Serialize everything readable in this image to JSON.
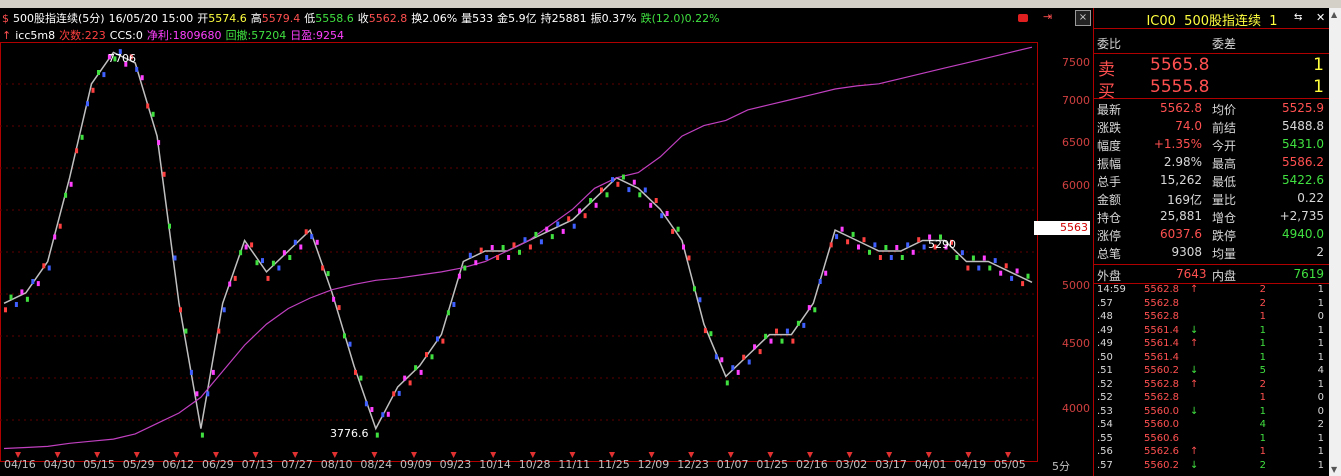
{
  "header": {
    "icon": "dollar-icon",
    "name": "500股指连续",
    "period": "(5分)",
    "datetime": "16/05/20 15:00",
    "open_label": "开",
    "open": "5574.6",
    "high_label": "高",
    "high": "5579.4",
    "low_label": "低",
    "low": "5558.6",
    "close_label": "收",
    "close": "5562.8",
    "turnover": "换2.06%",
    "volume": "量533",
    "amount": "金5.9亿",
    "holding": "持25881",
    "amplitude": "振0.37%",
    "change": "跌(12.0)0.22%"
  },
  "indicator": {
    "arrow": "↑",
    "name": "icc5m8",
    "trades": "次数:223",
    "ccs": "CCS:0",
    "net_profit": "净利:1809680",
    "drawdown": "回撤:57204",
    "daily": "日盈:9254"
  },
  "y_axis": [
    "7500",
    "7000",
    "6500",
    "6000",
    "5500",
    "5000",
    "4500",
    "4000"
  ],
  "x_axis": [
    "04/16",
    "04/30",
    "05/15",
    "05/29",
    "06/12",
    "06/29",
    "07/13",
    "07/27",
    "08/10",
    "08/24",
    "09/09",
    "09/23",
    "10/14",
    "10/28",
    "11/11",
    "11/25",
    "12/09",
    "12/23",
    "01/07",
    "01/25",
    "02/16",
    "03/02",
    "03/17",
    "04/01",
    "04/19",
    "05/05"
  ],
  "period_tab": "5分",
  "price_marker": "5563",
  "annotations": {
    "high": "7706",
    "low": "3776.6",
    "mid": "5290"
  },
  "chart_data": {
    "type": "line",
    "series": [
      {
        "values": [
          5200,
          5300,
          5600,
          6400,
          7300,
          7600,
          7500,
          6800,
          5200,
          4000,
          5200,
          5800,
          5500,
          5700,
          5900,
          5300,
          4600,
          4000,
          4400,
          4600,
          4900,
          5600,
          5700,
          5700,
          5800,
          5900,
          6000,
          6200,
          6400,
          6300,
          6100,
          5800,
          5000,
          4500,
          4700,
          4900,
          4900,
          5200,
          5900,
          5800,
          5700,
          5700,
          5800,
          5800,
          5600,
          5600,
          5500,
          5400
        ]
      },
      {
        "values": [
          3810,
          3820,
          3830,
          3860,
          3880,
          3900,
          3950,
          4050,
          4150,
          4300,
          4550,
          4800,
          5000,
          5150,
          5250,
          5330,
          5380,
          5420,
          5440,
          5470,
          5500,
          5540,
          5600,
          5700,
          5800,
          5950,
          6100,
          6300,
          6400,
          6450,
          6600,
          6800,
          6900,
          6950,
          7050,
          7100,
          7150,
          7200,
          7250,
          7280,
          7300,
          7350,
          7400,
          7450,
          7500,
          7550,
          7600,
          7650
        ]
      }
    ],
    "colors": [
      "#c0c0c0",
      "#c040c0"
    ],
    "ylim": [
      3700,
      7700
    ]
  },
  "panel": {
    "code": "IC00",
    "name": "500股指连续",
    "num": "1",
    "ratio_label": "委比",
    "diff_label": "委差",
    "sell_label": "卖",
    "sell_price": "5565.8",
    "sell_vol": "1",
    "buy_label": "买",
    "buy_price": "5555.8",
    "buy_vol": "1",
    "stats": [
      {
        "l1": "最新",
        "v1": "5562.8",
        "c1": "#ff5050",
        "l2": "均价",
        "v2": "5525.9",
        "c2": "#ff5050"
      },
      {
        "l1": "涨跌",
        "v1": "74.0",
        "c1": "#ff5050",
        "l2": "前结",
        "v2": "5488.8",
        "c2": "#d8d8d8"
      },
      {
        "l1": "幅度",
        "v1": "+1.35%",
        "c1": "#ff5050",
        "l2": "今开",
        "v2": "5431.0",
        "c2": "#40e040"
      },
      {
        "l1": "振幅",
        "v1": "2.98%",
        "c1": "#d8d8d8",
        "l2": "最高",
        "v2": "5586.2",
        "c2": "#ff5050"
      },
      {
        "l1": "总手",
        "v1": "15,262",
        "c1": "#d8d8d8",
        "l2": "最低",
        "v2": "5422.6",
        "c2": "#40e040"
      },
      {
        "l1": "金额",
        "v1": "169亿",
        "c1": "#d8d8d8",
        "l2": "量比",
        "v2": "0.22",
        "c2": "#d8d8d8"
      },
      {
        "l1": "持仓",
        "v1": "25,881",
        "c1": "#d8d8d8",
        "l2": "增仓",
        "v2": "+2,735",
        "c2": "#d8d8d8"
      },
      {
        "l1": "涨停",
        "v1": "6037.6",
        "c1": "#ff5050",
        "l2": "跌停",
        "v2": "4940.0",
        "c2": "#40e040"
      },
      {
        "l1": "总笔",
        "v1": "9308",
        "c1": "#d8d8d8",
        "l2": "均量",
        "v2": "2",
        "c2": "#d8d8d8"
      }
    ],
    "outer_label": "外盘",
    "outer": "7643",
    "inner_label": "内盘",
    "inner": "7619",
    "ticks": [
      {
        "t": "14:59",
        "p": "5562.8",
        "a": "↑",
        "ac": "#ff5050",
        "v": "2",
        "vc": "#ff5050",
        "n": "1"
      },
      {
        "t": ".57",
        "p": "5562.8",
        "a": "",
        "ac": "",
        "v": "2",
        "vc": "#ff5050",
        "n": "1"
      },
      {
        "t": ".48",
        "p": "5562.8",
        "a": "",
        "ac": "",
        "v": "1",
        "vc": "#ff5050",
        "n": "0"
      },
      {
        "t": ".49",
        "p": "5561.4",
        "a": "↓",
        "ac": "#40e040",
        "v": "1",
        "vc": "#40e040",
        "n": "1"
      },
      {
        "t": ".49",
        "p": "5561.4",
        "a": "↑",
        "ac": "#ff5050",
        "v": "1",
        "vc": "#40e040",
        "n": "1"
      },
      {
        "t": ".50",
        "p": "5561.4",
        "a": "",
        "ac": "",
        "v": "1",
        "vc": "#40e040",
        "n": "1"
      },
      {
        "t": ".51",
        "p": "5560.2",
        "a": "↓",
        "ac": "#40e040",
        "v": "5",
        "vc": "#40e040",
        "n": "4"
      },
      {
        "t": ".52",
        "p": "5562.8",
        "a": "↑",
        "ac": "#ff5050",
        "v": "2",
        "vc": "#ff5050",
        "n": "1"
      },
      {
        "t": ".52",
        "p": "5562.8",
        "a": "",
        "ac": "",
        "v": "1",
        "vc": "#ff5050",
        "n": "0"
      },
      {
        "t": ".53",
        "p": "5560.0",
        "a": "↓",
        "ac": "#40e040",
        "v": "1",
        "vc": "#40e040",
        "n": "0"
      },
      {
        "t": ".54",
        "p": "5560.0",
        "a": "",
        "ac": "",
        "v": "4",
        "vc": "#40e040",
        "n": "2"
      },
      {
        "t": ".55",
        "p": "5560.6",
        "a": "",
        "ac": "",
        "v": "1",
        "vc": "#40e040",
        "n": "1"
      },
      {
        "t": ".56",
        "p": "5562.6",
        "a": "↑",
        "ac": "#ff5050",
        "v": "1",
        "vc": "#ff5050",
        "n": "1"
      },
      {
        "t": ".57",
        "p": "5560.2",
        "a": "↓",
        "ac": "#40e040",
        "v": "2",
        "vc": "#40e040",
        "n": "1"
      }
    ]
  }
}
